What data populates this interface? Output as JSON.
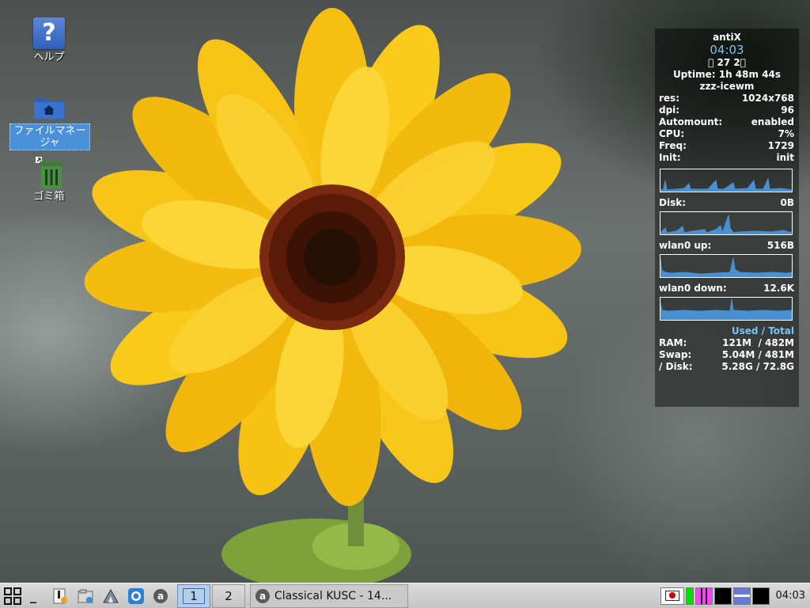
{
  "desktop": {
    "icons": [
      {
        "label": "ヘルプ",
        "glyph": "?"
      },
      {
        "label": "ファイルマネージャ"
      },
      {
        "label": "ゴミ箱"
      }
    ]
  },
  "conky": {
    "distro": "antiX",
    "time": "04:03",
    "date": "\u0000 27  2\u0000",
    "uptime": "Uptime: 1h 48m 44s",
    "session": "zzz-icewm",
    "rows": [
      {
        "label": "res:",
        "value": "1024x768"
      },
      {
        "label": "dpi:",
        "value": "96"
      },
      {
        "label": "Automount:",
        "value": "enabled"
      },
      {
        "label": "CPU:",
        "value": "7%"
      },
      {
        "label": "Freq:",
        "value": "1729"
      },
      {
        "label": "Init:",
        "value": "init"
      }
    ],
    "disk": {
      "label": "Disk:",
      "value": "0B"
    },
    "wlan_up": {
      "label": "wlan0 up:",
      "value": "516B"
    },
    "wlan_down": {
      "label": "wlan0 down:",
      "value": "12.6K"
    },
    "used_total_header": "Used / Total",
    "memory": [
      {
        "label": "RAM:",
        "value": "121M  / 482M"
      },
      {
        "label": "Swap:",
        "value": "5.04M / 481M"
      },
      {
        "label": "/ Disk:",
        "value": "5.28G / 72.8G"
      }
    ]
  },
  "taskbar": {
    "menu_icon": "grid-menu-icon",
    "show_desktop": "_",
    "quicklaunch": [
      "text-editor-icon",
      "file-manager-icon",
      "antix-control-centre-icon",
      "browser-icon",
      "audio-player-icon"
    ],
    "workspaces": [
      {
        "label": "1",
        "active": true
      },
      {
        "label": "2",
        "active": false
      }
    ],
    "task": {
      "badge": "a",
      "title": "Classical KUSC - 14..."
    },
    "clock": "04:03",
    "accent": "#4a90d9"
  }
}
